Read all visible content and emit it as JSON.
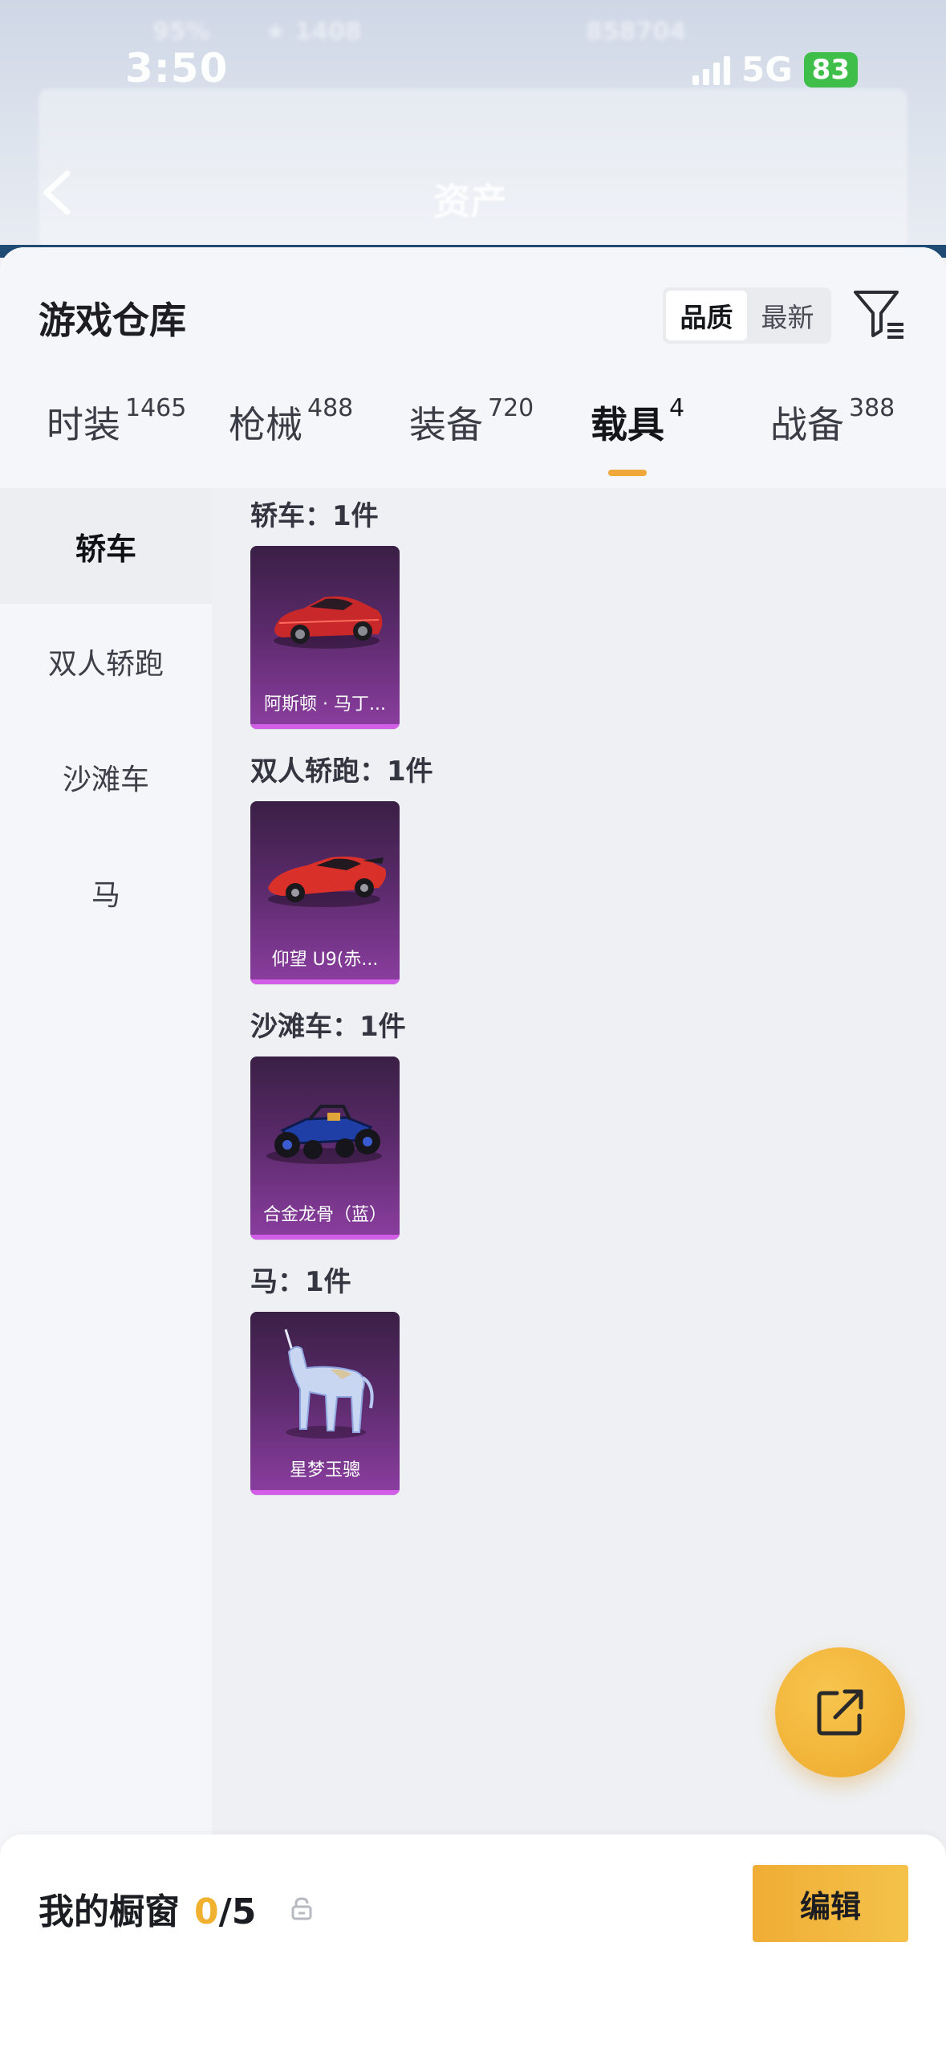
{
  "status_bar": {
    "time": "3:50",
    "network": "5G",
    "battery": "83"
  },
  "header": {
    "title": "资产"
  },
  "warehouse": {
    "title": "游戏仓库",
    "sort_options": [
      "品质",
      "最新"
    ],
    "sort_selected": "品质"
  },
  "tabs": [
    {
      "label": "时装",
      "count": "1465"
    },
    {
      "label": "枪械",
      "count": "488"
    },
    {
      "label": "装备",
      "count": "720"
    },
    {
      "label": "载具",
      "count": "4"
    },
    {
      "label": "战备",
      "count": "388"
    }
  ],
  "active_tab": "载具",
  "sidebar": {
    "items": [
      "轿车",
      "双人轿跑",
      "沙滩车",
      "马"
    ],
    "active": "轿车"
  },
  "sections": [
    {
      "title": "轿车：1件",
      "items": [
        {
          "name": "阿斯顿 · 马丁...",
          "art": "red-sports-car"
        }
      ]
    },
    {
      "title": "双人轿跑：1件",
      "items": [
        {
          "name": "仰望 U9(赤...",
          "art": "red-supercar"
        }
      ]
    },
    {
      "title": "沙滩车：1件",
      "items": [
        {
          "name": "合金龙骨（蓝）",
          "art": "blue-buggy"
        }
      ]
    },
    {
      "title": "马：1件",
      "items": [
        {
          "name": "星梦玉骢",
          "art": "crystal-unicorn"
        }
      ]
    }
  ],
  "bottom": {
    "label": "我的橱窗",
    "count_current": "0",
    "count_total": "/5",
    "edit_label": "编辑"
  },
  "colors": {
    "accent": "#f0b12f",
    "card_purple": "#8b3ea0"
  }
}
